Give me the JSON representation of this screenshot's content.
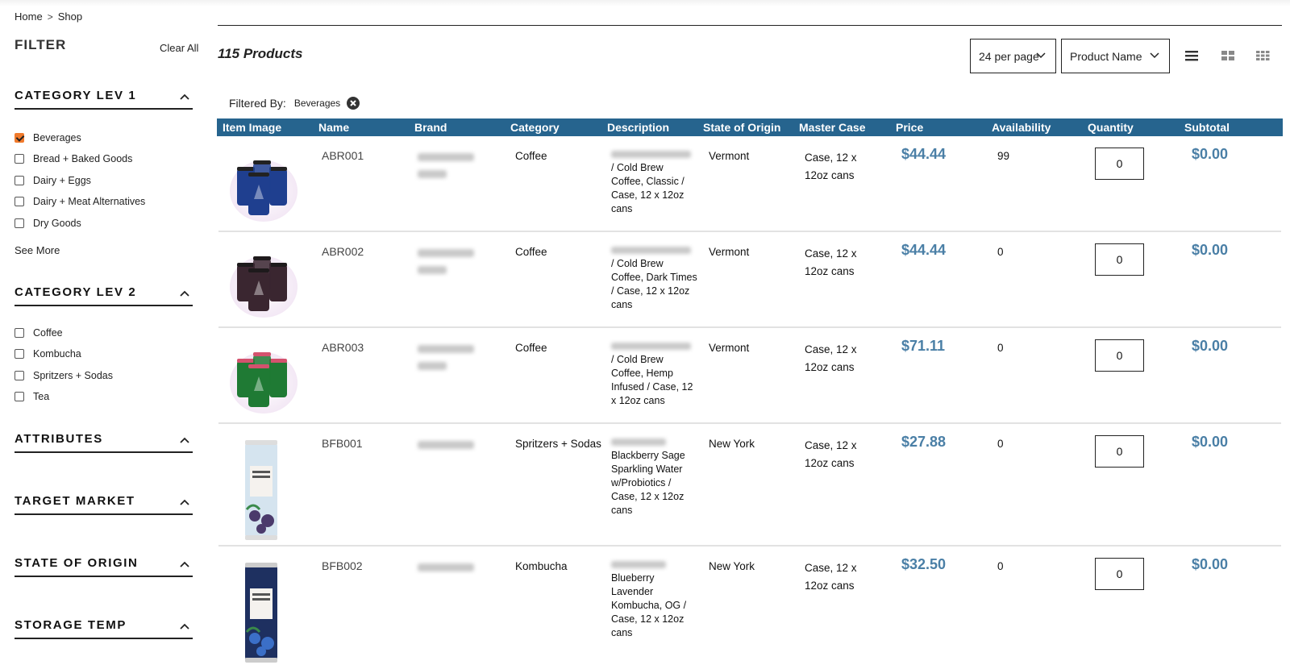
{
  "breadcrumb": {
    "home": "Home",
    "separator": ">",
    "current": "Shop"
  },
  "sidebar": {
    "filter_title": "FILTER",
    "clear_all": "Clear All",
    "category_lev1": {
      "title": "CATEGORY LEV 1",
      "options": [
        {
          "label": "Beverages",
          "checked": true
        },
        {
          "label": "Bread + Baked Goods",
          "checked": false
        },
        {
          "label": "Dairy + Eggs",
          "checked": false
        },
        {
          "label": "Dairy + Meat Alternatives",
          "checked": false
        },
        {
          "label": "Dry Goods",
          "checked": false
        }
      ],
      "see_more": "See More"
    },
    "category_lev2": {
      "title": "CATEGORY LEV 2",
      "options": [
        {
          "label": "Coffee",
          "checked": false
        },
        {
          "label": "Kombucha",
          "checked": false
        },
        {
          "label": "Spritzers + Sodas",
          "checked": false
        },
        {
          "label": "Tea",
          "checked": false
        }
      ]
    },
    "sections": [
      "ATTRIBUTES",
      "TARGET MARKET",
      "STATE OF ORIGIN",
      "STORAGE TEMP"
    ]
  },
  "toolbar": {
    "product_count": "115 Products",
    "per_page": "24 per page",
    "sort_by": "Product Name",
    "views": [
      "list-view",
      "grid-view",
      "compact-grid-view"
    ]
  },
  "filtered_by": {
    "label": "Filtered By:",
    "tag": "Beverages"
  },
  "table": {
    "headers": [
      "Item Image",
      "Name",
      "Brand",
      "Category",
      "Description",
      "State of Origin",
      "Master Case",
      "Price",
      "Availability",
      "Quantity",
      "Subtotal"
    ],
    "rows": [
      {
        "sku": "ABR001",
        "category": "Coffee",
        "description": "/ Cold Brew Coffee, Classic / Case, 12 x 12oz cans",
        "state": "Vermont",
        "master_case": "Case, 12 x 12oz cans",
        "price": "$44.44",
        "availability": "99",
        "quantity": "0",
        "subtotal": "$0.00",
        "image": "blue-four-pack-cans"
      },
      {
        "sku": "ABR002",
        "category": "Coffee",
        "description": "/ Cold Brew Coffee, Dark Times / Case, 12 x 12oz cans",
        "state": "Vermont",
        "master_case": "Case, 12 x 12oz cans",
        "price": "$44.44",
        "availability": "0",
        "quantity": "0",
        "subtotal": "$0.00",
        "image": "dark-four-pack-cans"
      },
      {
        "sku": "ABR003",
        "category": "Coffee",
        "description": "/ Cold Brew Coffee, Hemp Infused / Case, 12 x 12oz cans",
        "state": "Vermont",
        "master_case": "Case, 12 x 12oz cans",
        "price": "$71.11",
        "availability": "0",
        "quantity": "0",
        "subtotal": "$0.00",
        "image": "green-four-pack-cans"
      },
      {
        "sku": "BFB001",
        "category": "Spritzers + Sodas",
        "description": "Blackberry Sage Sparkling Water w/Probiotics / Case, 12 x 12oz cans",
        "state": "New York",
        "master_case": "Case, 12 x 12oz cans",
        "price": "$27.88",
        "availability": "0",
        "quantity": "0",
        "subtotal": "$0.00",
        "image": "light-blue-slim-can"
      },
      {
        "sku": "BFB002",
        "category": "Kombucha",
        "description": "Blueberry Lavender Kombucha, OG / Case, 12 x 12oz cans",
        "state": "New York",
        "master_case": "Case, 12 x 12oz cans",
        "price": "$32.50",
        "availability": "0",
        "quantity": "0",
        "subtotal": "$0.00",
        "image": "navy-slim-can"
      }
    ]
  },
  "colors": {
    "header_bg": "#26648e",
    "price": "#4a7fa6",
    "checkbox_checked": "#f07a2c"
  }
}
